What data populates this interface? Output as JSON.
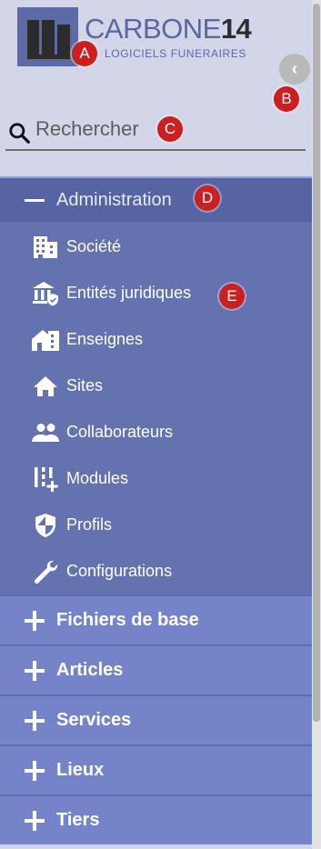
{
  "logo": {
    "brand": "CARBONE",
    "number": "14",
    "tagline": "LOGICIELS FUNERAIRES"
  },
  "collapse_button": {
    "icon": "chevron-left-icon"
  },
  "search": {
    "placeholder": "Rechercher",
    "value": "",
    "icon": "search-icon"
  },
  "menu": {
    "open_group": {
      "label": "Administration",
      "icon": "minus-icon",
      "items": [
        {
          "label": "Société",
          "icon": "building-icon"
        },
        {
          "label": "Entités juridiques",
          "icon": "bank-shield-icon"
        },
        {
          "label": "Enseignes",
          "icon": "storefront-icon"
        },
        {
          "label": "Sites",
          "icon": "home-icon"
        },
        {
          "label": "Collaborateurs",
          "icon": "people-icon"
        },
        {
          "label": "Modules",
          "icon": "modules-add-icon"
        },
        {
          "label": "Profils",
          "icon": "shield-icon"
        },
        {
          "label": "Configurations",
          "icon": "wrench-icon"
        }
      ]
    },
    "collapsed_groups": [
      {
        "label": "Fichiers de base",
        "icon": "plus-icon"
      },
      {
        "label": "Articles",
        "icon": "plus-icon"
      },
      {
        "label": "Services",
        "icon": "plus-icon"
      },
      {
        "label": "Lieux",
        "icon": "plus-icon"
      },
      {
        "label": "Tiers",
        "icon": "plus-icon"
      }
    ]
  },
  "markers": [
    "A",
    "B",
    "C",
    "D",
    "E"
  ],
  "colors": {
    "sidebar_bg": "#d2d6e8",
    "open_group_header": "#5664a3",
    "open_group_body": "#6473b0",
    "collapsed_group": "#7584c9",
    "marker": "#cc1f1f"
  }
}
